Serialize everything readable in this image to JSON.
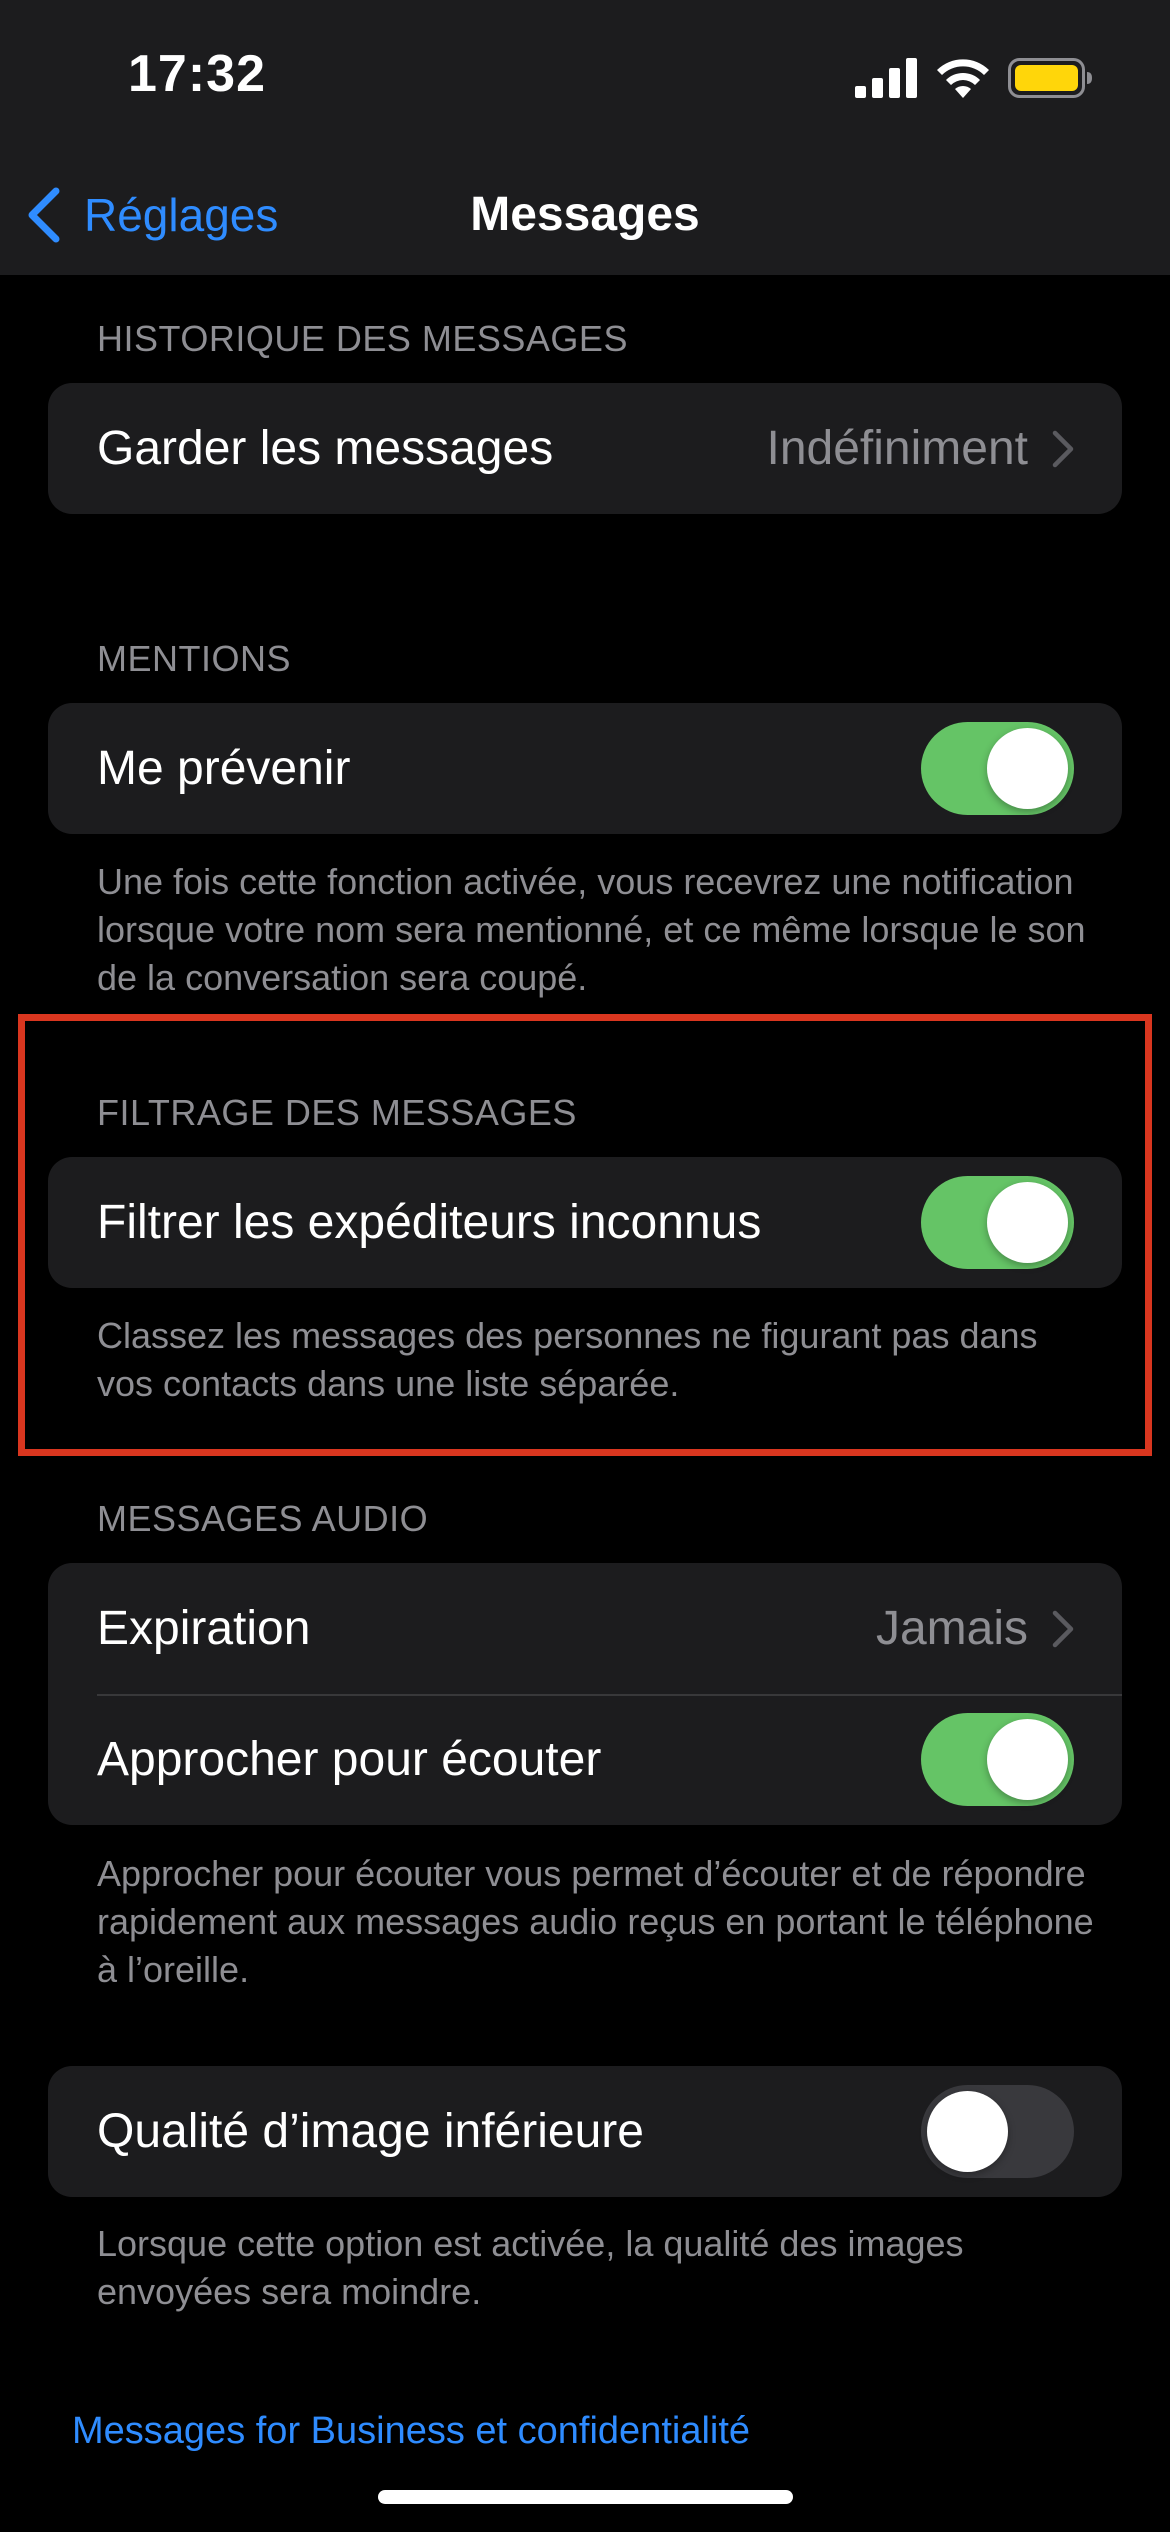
{
  "status": {
    "time": "17:32"
  },
  "nav": {
    "back_label": "Réglages",
    "title": "Messages"
  },
  "sections": {
    "history": {
      "header": "HISTORIQUE DES MESSAGES",
      "keep_label": "Garder les messages",
      "keep_value": "Indéfiniment"
    },
    "mentions": {
      "header": "MENTIONS",
      "notify_label": "Me prévenir",
      "notify_on": true,
      "footer": "Une fois cette fonction activée, vous recevrez une notification lorsque votre nom sera mentionné, et ce même lorsque le son de la conversation sera coupé."
    },
    "filtering": {
      "header": "FILTRAGE DES MESSAGES",
      "filter_label": "Filtrer les expéditeurs inconnus",
      "filter_on": true,
      "footer": "Classez les messages des personnes ne figurant pas dans vos contacts dans une liste séparée."
    },
    "audio": {
      "header": "MESSAGES AUDIO",
      "expiration_label": "Expiration",
      "expiration_value": "Jamais",
      "raise_label": "Approcher pour écouter",
      "raise_on": true,
      "footer": "Approcher pour écouter vous permet d’écouter et de répondre rapidement aux messages audio reçus en portant le téléphone à l’oreille."
    },
    "image": {
      "low_quality_label": "Qualité d’image inférieure",
      "low_quality_on": false,
      "footer": "Lorsque cette option est activée, la qualité des images envoyées sera moindre."
    }
  },
  "footer_link": "Messages for Business et confidentialité",
  "colors": {
    "accent": "#2f8cff",
    "toggle_on": "#65c466",
    "highlight": "#d9361f"
  }
}
